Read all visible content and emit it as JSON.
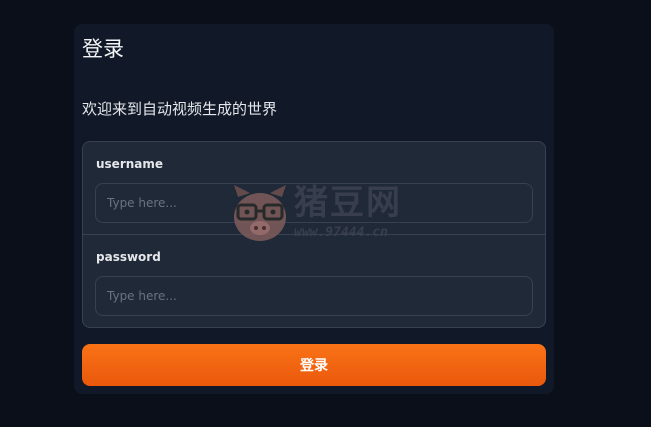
{
  "login": {
    "title": "登录",
    "subtitle": "欢迎来到自动视频生成的世界",
    "fields": [
      {
        "label": "username",
        "placeholder": "Type here...",
        "value": ""
      },
      {
        "label": "password",
        "placeholder": "Type here...",
        "value": ""
      }
    ],
    "submit_label": "登录"
  },
  "watermark": {
    "text": "猪豆网",
    "url": "www.97444.cn"
  },
  "colors": {
    "background": "#0b0f19",
    "card": "#111827",
    "panel": "#1f2937",
    "border": "#374151",
    "accent": "#f97316"
  }
}
